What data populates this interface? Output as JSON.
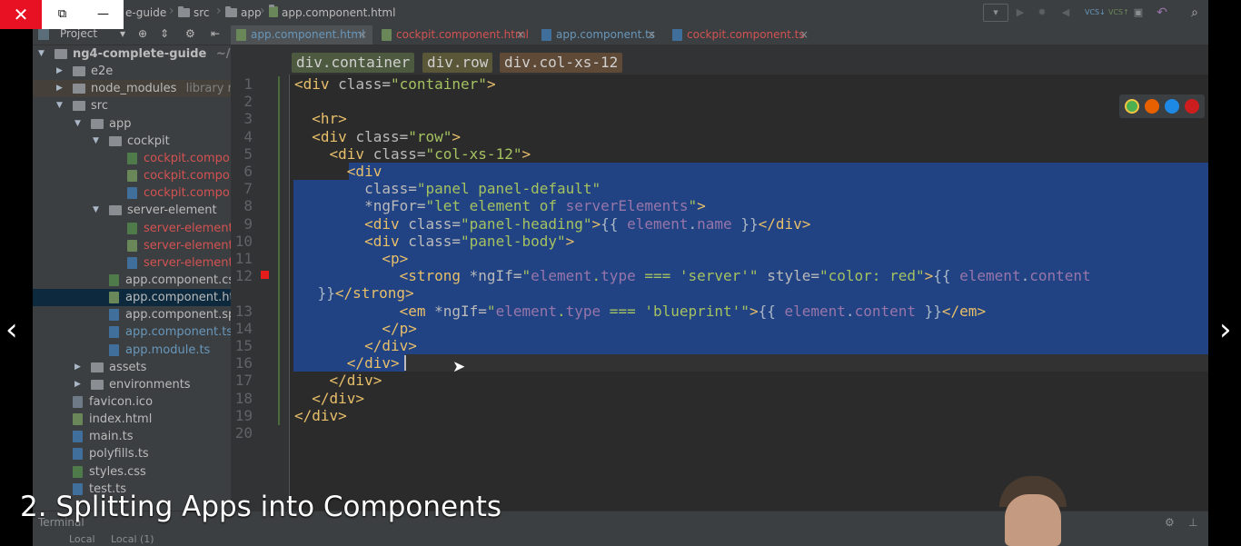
{
  "window_controls": {
    "close": "✕",
    "restore": "⧉",
    "minimize": "—"
  },
  "navbar": {
    "crumbs": [
      "e-guide",
      "src",
      "app",
      "app.component.html"
    ]
  },
  "toolbar_icons": [
    "run-config-dropdown",
    "run-icon",
    "debug-icon",
    "coverage-icon",
    "vcs-update-icon",
    "vcs-commit-icon",
    "history-icon",
    "revert-icon",
    "search-icon"
  ],
  "project_panel": {
    "title": "Project",
    "dropdown": "▾"
  },
  "tabs": [
    {
      "label": "app.component.html",
      "active": true
    },
    {
      "label": "cockpit.component.html",
      "active": false
    },
    {
      "label": "app.component.ts",
      "active": false
    },
    {
      "label": "cockpit.component.ts",
      "active": false
    }
  ],
  "tree": [
    {
      "label": "ng4-complete-guide",
      "extra": "~/dev",
      "depth": 0,
      "kind": "folder",
      "open": true
    },
    {
      "label": "e2e",
      "depth": 1,
      "kind": "folder",
      "open": false
    },
    {
      "label": "node_modules",
      "extra": "library roo",
      "depth": 1,
      "kind": "folder",
      "open": false
    },
    {
      "label": "src",
      "depth": 1,
      "kind": "folder",
      "open": true
    },
    {
      "label": "app",
      "depth": 2,
      "kind": "folder",
      "open": true
    },
    {
      "label": "cockpit",
      "depth": 3,
      "kind": "folder",
      "open": true
    },
    {
      "label": "cockpit.compon",
      "depth": 5,
      "kind": "css",
      "color": "#d25252"
    },
    {
      "label": "cockpit.compon",
      "depth": 5,
      "kind": "html",
      "color": "#d25252"
    },
    {
      "label": "cockpit.compon",
      "depth": 5,
      "kind": "ts",
      "color": "#d25252"
    },
    {
      "label": "server-element",
      "depth": 3,
      "kind": "folder",
      "open": true
    },
    {
      "label": "server-element.",
      "depth": 5,
      "kind": "css",
      "color": "#d25252"
    },
    {
      "label": "server-element.",
      "depth": 5,
      "kind": "html",
      "color": "#d25252"
    },
    {
      "label": "server-element.",
      "depth": 5,
      "kind": "ts",
      "color": "#d25252"
    },
    {
      "label": "app.component.css",
      "depth": 4,
      "kind": "css",
      "color": "#bbbbbb"
    },
    {
      "label": "app.component.ht",
      "depth": 4,
      "kind": "html",
      "color": "#bbbbbb",
      "selected": true
    },
    {
      "label": "app.component.sp",
      "depth": 4,
      "kind": "ts",
      "color": "#bbbbbb"
    },
    {
      "label": "app.component.ts",
      "depth": 4,
      "kind": "ts",
      "color": "#6897bb"
    },
    {
      "label": "app.module.ts",
      "depth": 4,
      "kind": "ts",
      "color": "#6897bb"
    },
    {
      "label": "assets",
      "depth": 2,
      "kind": "folder",
      "open": false
    },
    {
      "label": "environments",
      "depth": 2,
      "kind": "folder",
      "open": false
    },
    {
      "label": "favicon.ico",
      "depth": 2,
      "kind": "file",
      "color": "#bbbbbb"
    },
    {
      "label": "index.html",
      "depth": 2,
      "kind": "html",
      "color": "#bbbbbb"
    },
    {
      "label": "main.ts",
      "depth": 2,
      "kind": "ts",
      "color": "#bbbbbb"
    },
    {
      "label": "polyfills.ts",
      "depth": 2,
      "kind": "ts",
      "color": "#bbbbbb"
    },
    {
      "label": "styles.css",
      "depth": 2,
      "kind": "css",
      "color": "#bbbbbb"
    },
    {
      "label": "test.ts",
      "depth": 2,
      "kind": "ts",
      "color": "#bbbbbb"
    }
  ],
  "breadcrumb_chips": [
    {
      "label": "div.container",
      "color": "#4e5a3f"
    },
    {
      "label": "div.row",
      "color": "#5a5638"
    },
    {
      "label": "div.col-xs-12",
      "color": "#5e4a36"
    }
  ],
  "code": {
    "line_numbers": [
      "1",
      "2",
      "3",
      "4",
      "5",
      "6",
      "7",
      "8",
      "9",
      "10",
      "11",
      "12",
      "",
      "13",
      "14",
      "15",
      "16",
      "17",
      "18",
      "19",
      "20"
    ],
    "lines": [
      [
        [
          "tag",
          "<div "
        ],
        [
          "attr",
          "class="
        ],
        [
          "val",
          "\"container\""
        ],
        [
          "tag",
          ">"
        ]
      ],
      [],
      [
        [
          "plain",
          "  "
        ],
        [
          "tag",
          "<hr>"
        ]
      ],
      [
        [
          "plain",
          "  "
        ],
        [
          "tag",
          "<div "
        ],
        [
          "attr",
          "class="
        ],
        [
          "val",
          "\"row\""
        ],
        [
          "tag",
          ">"
        ]
      ],
      [
        [
          "plain",
          "    "
        ],
        [
          "tag",
          "<div "
        ],
        [
          "attr",
          "class="
        ],
        [
          "val",
          "\"col-xs-12\""
        ],
        [
          "tag",
          ">"
        ]
      ],
      [
        [
          "plain",
          "      "
        ],
        [
          "tag",
          "<div"
        ]
      ],
      [
        [
          "plain",
          "        "
        ],
        [
          "attr",
          "class="
        ],
        [
          "val",
          "\"panel panel-default\""
        ]
      ],
      [
        [
          "plain",
          "        "
        ],
        [
          "attr",
          "*ngFor="
        ],
        [
          "val",
          "\"let element of "
        ],
        [
          "interp",
          "serverElements"
        ],
        [
          "val",
          "\""
        ],
        [
          "tag",
          ">"
        ]
      ],
      [
        [
          "plain",
          "        "
        ],
        [
          "tag",
          "<div "
        ],
        [
          "attr",
          "class="
        ],
        [
          "val",
          "\"panel-heading\""
        ],
        [
          "tag",
          ">"
        ],
        [
          "plain",
          "{{ "
        ],
        [
          "interp",
          "element"
        ],
        [
          "plain",
          "."
        ],
        [
          "interp",
          "name"
        ],
        [
          "plain",
          " }}"
        ],
        [
          "tag",
          "</div>"
        ]
      ],
      [
        [
          "plain",
          "        "
        ],
        [
          "tag",
          "<div "
        ],
        [
          "attr",
          "class="
        ],
        [
          "val",
          "\"panel-body\""
        ],
        [
          "tag",
          ">"
        ]
      ],
      [
        [
          "plain",
          "          "
        ],
        [
          "tag",
          "<p>"
        ]
      ],
      [
        [
          "plain",
          "            "
        ],
        [
          "tag",
          "<strong "
        ],
        [
          "attr",
          "*ngIf="
        ],
        [
          "val",
          "\""
        ],
        [
          "interp",
          "element"
        ],
        [
          "val",
          "."
        ],
        [
          "interp",
          "type"
        ],
        [
          "val",
          " === 'server'\""
        ],
        [
          "attr",
          " style="
        ],
        [
          "val",
          "\"color: red\""
        ],
        [
          "tag",
          ">"
        ],
        [
          "plain",
          "{{ "
        ],
        [
          "interp",
          "element"
        ],
        [
          "plain",
          "."
        ],
        [
          "interp",
          "content"
        ]
      ],
      [
        [
          "plain",
          " }}"
        ],
        [
          "tag",
          "</strong>"
        ]
      ],
      [
        [
          "plain",
          "            "
        ],
        [
          "tag",
          "<em "
        ],
        [
          "attr",
          "*ngIf="
        ],
        [
          "val",
          "\""
        ],
        [
          "interp",
          "element"
        ],
        [
          "val",
          "."
        ],
        [
          "interp",
          "type"
        ],
        [
          "val",
          " === 'blueprint'\""
        ],
        [
          "tag",
          ">"
        ],
        [
          "plain",
          "{{ "
        ],
        [
          "interp",
          "element"
        ],
        [
          "plain",
          "."
        ],
        [
          "interp",
          "content"
        ],
        [
          "plain",
          " }}"
        ],
        [
          "tag",
          "</em>"
        ]
      ],
      [
        [
          "plain",
          "          "
        ],
        [
          "tag",
          "</p>"
        ]
      ],
      [
        [
          "plain",
          "        "
        ],
        [
          "tag",
          "</div>"
        ]
      ],
      [
        [
          "plain",
          "      "
        ],
        [
          "tag",
          "</div>"
        ]
      ],
      [
        [
          "plain",
          "    "
        ],
        [
          "tag",
          "</div>"
        ]
      ],
      [
        [
          "plain",
          "  "
        ],
        [
          "tag",
          "</div>"
        ]
      ],
      [
        [
          "tag",
          "</div>"
        ]
      ],
      []
    ]
  },
  "subtitle": "2. Splitting Apps into Components",
  "terminal": {
    "title": "Terminal",
    "tabs": [
      "Local",
      "Local (1)"
    ]
  },
  "colors": {
    "selection": "#214283",
    "error_marker": "#e31c1c",
    "close_button": "#e81123"
  }
}
